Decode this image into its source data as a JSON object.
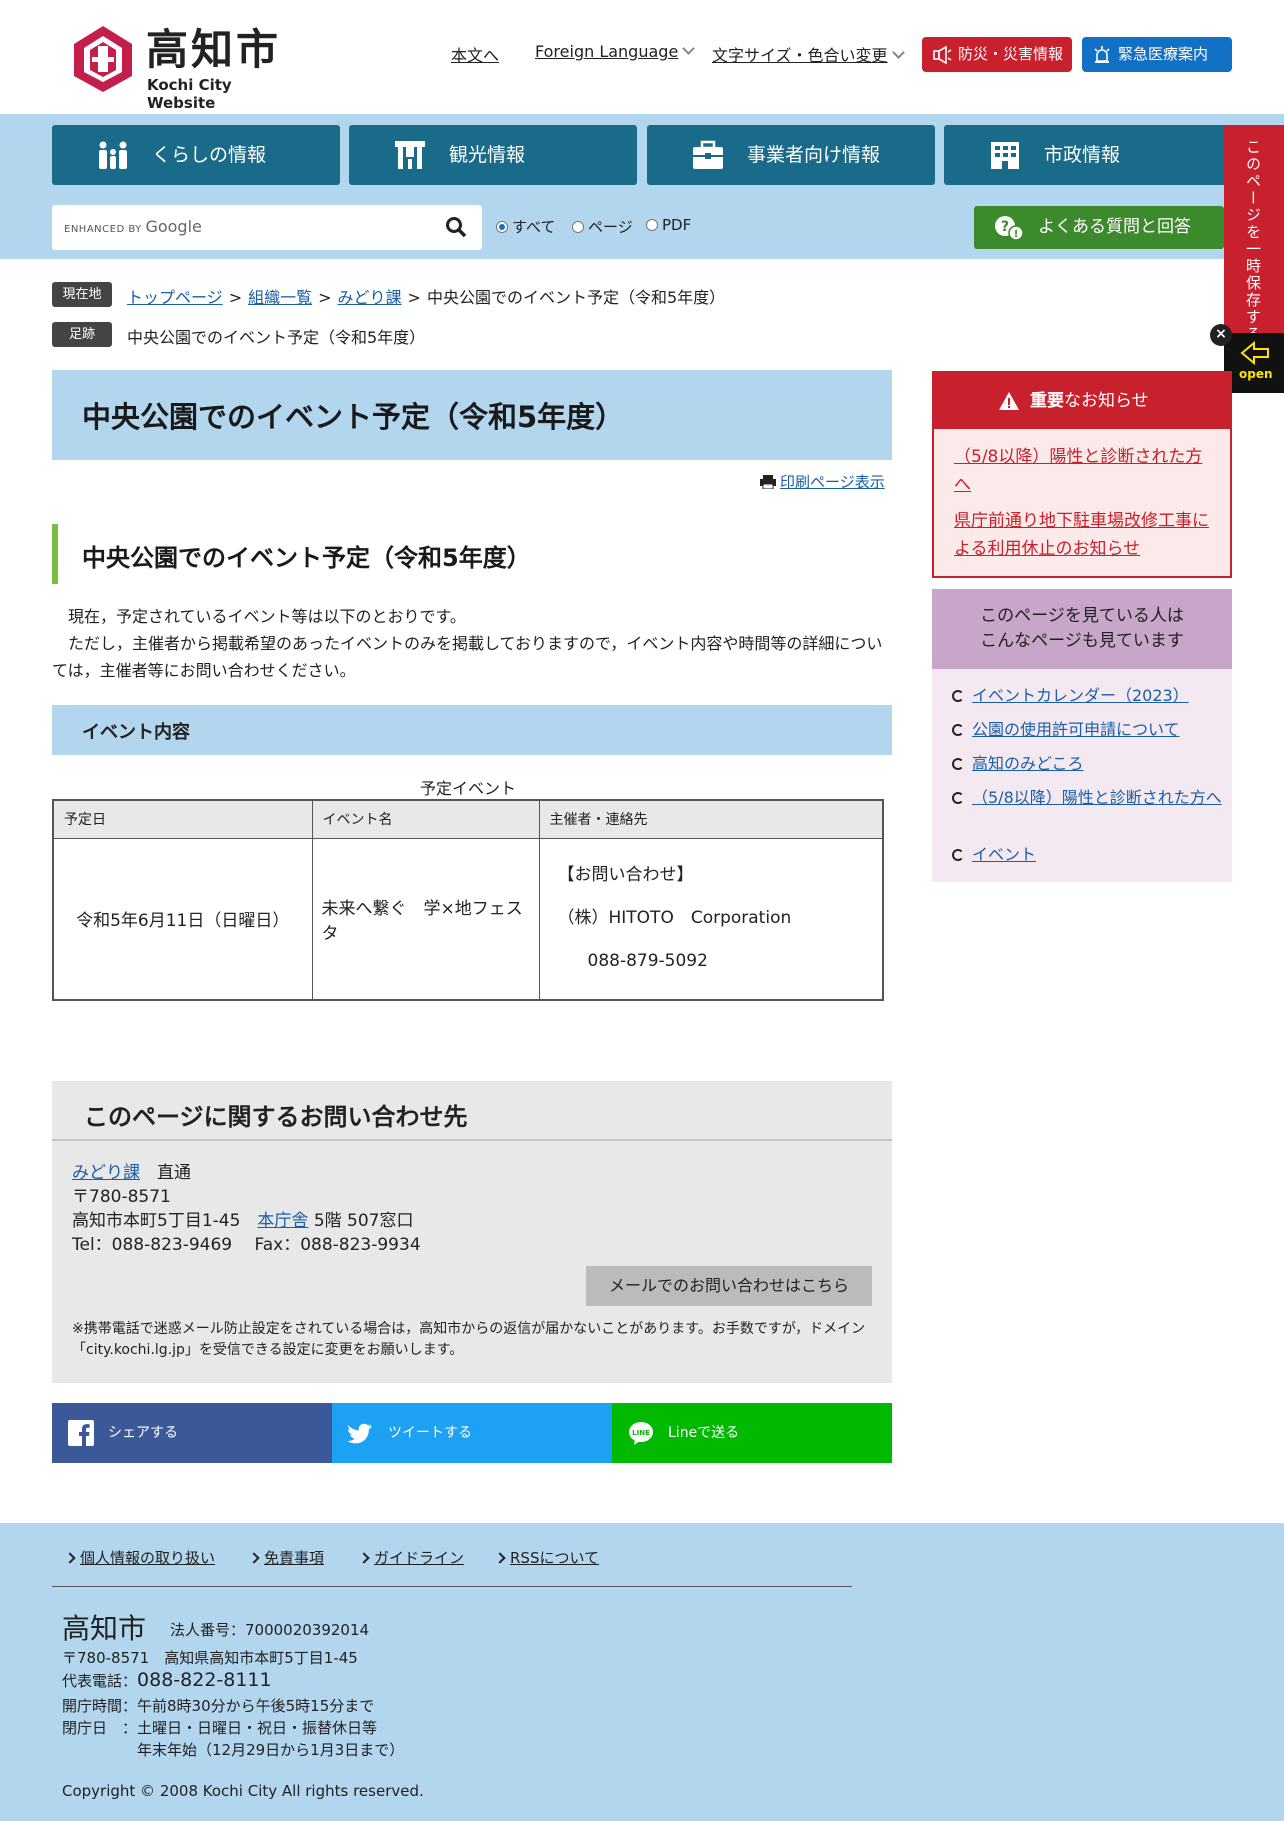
{
  "header": {
    "logo_title": "高知市",
    "logo_sub": "Kochi City Website",
    "links": [
      "本文へ",
      "Foreign Language",
      "文字サイズ・色合い変更"
    ],
    "disaster_btn": "防災・災害情報",
    "medical_btn": "緊急医療案内"
  },
  "nav": [
    "くらしの情報",
    "観光情報",
    "事業者向け情報",
    "市政情報"
  ],
  "search": {
    "enhanced_by": "ENHANCED BY",
    "google": "Google",
    "radio_all": "すべて",
    "radio_page": "ページ",
    "radio_pdf": "PDF"
  },
  "faq_btn": "よくある質問と回答",
  "side_tab": {
    "label": "このページを一時保存する",
    "open": "open",
    "close": "×"
  },
  "breadcrumb": {
    "current_tag": "現在地",
    "trail_tag": "足跡",
    "items": [
      "トップページ",
      "組織一覧",
      "みどり課"
    ],
    "sep": ">",
    "current": "中央公園でのイベント予定（令和5年度）",
    "trail": "中央公園でのイベント予定（令和5年度）"
  },
  "main": {
    "title": "中央公園でのイベント予定（令和5年度）",
    "print_link": "印刷ページ表示",
    "h2": "中央公園でのイベント予定（令和5年度）",
    "para1": "現在，予定されているイベント等は以下のとおりです。",
    "para2": "ただし，主催者から掲載希望のあったイベントのみを掲載しておりますので，イベント内容や時間等の詳細については，主催者等にお問い合わせください。",
    "h3": "イベント内容",
    "table": {
      "caption": "予定イベント",
      "headers": [
        "予定日",
        "イベント名",
        "主催者・連絡先"
      ],
      "row": {
        "date": "令和5年6月11日（日曜日）",
        "name": "未来へ繋ぐ　学×地フェスタ",
        "contact_1": "【お問い合わせ】",
        "contact_2": "（株）HITOTO　Corporation",
        "contact_3": "088-879-5092"
      }
    }
  },
  "contact": {
    "title": "このページに関するお問い合わせ先",
    "dept": "みどり課",
    "dept_suffix": "直通",
    "zip": "〒780-8571",
    "addr": "高知市本町5丁目1-45",
    "bldg": "本庁舎",
    "floor": "5階 507窓口",
    "tel": "Tel：088-823-9469　 Fax：088-823-9934",
    "mail_btn": "メールでのお問い合わせはこちら",
    "note": "※携帯電話で迷惑メール防止設定をされている場合は，高知市からの返信が届かないことがあります。お手数ですが，ドメイン「city.kochi.lg.jp」を受信できる設定に変更をお願いします。"
  },
  "share": {
    "facebook": "シェアする",
    "twitter": "ツイートする",
    "line": "Lineで送る"
  },
  "notice": {
    "title_bold": "重要",
    "title_rest": "なお知らせ",
    "items": [
      "（5/8以降）陽性と診断された方へ",
      "県庁前通り地下駐車場改修工事による利用休止のお知らせ"
    ]
  },
  "related": {
    "title_1": "このページを見ている人は",
    "title_2": "こんなページも見ています",
    "items": [
      "イベントカレンダー（2023）",
      "公園の使用許可申請について",
      "高知のみどころ",
      "（5/8以降）陽性と診断された方へ",
      "イベント"
    ]
  },
  "footer": {
    "links": [
      "個人情報の取り扱い",
      "免責事項",
      "ガイドライン",
      "RSSについて"
    ],
    "name": "高知市",
    "corp": "法人番号：7000020392014",
    "addr": "〒780-8571　高知県高知市本町5丁目1-45",
    "tel_label": "代表電話：",
    "tel": "088-822-8111",
    "hours": "開庁時間：午前8時30分から午後5時15分まで",
    "closed_label": "閉庁日　：",
    "closed_1": "土曜日・日曜日・祝日・振替休日等",
    "closed_2": "年末年始（12月29日から1月3日まで）",
    "copyright": "Copyright © 2008 Kochi City All rights reserved."
  },
  "colors": {
    "band": "#b3d6ef",
    "nav": "#1a6b8a",
    "red": "#c8202c",
    "green": "#3d8a2c",
    "accent_bar": "#7dbb42"
  }
}
